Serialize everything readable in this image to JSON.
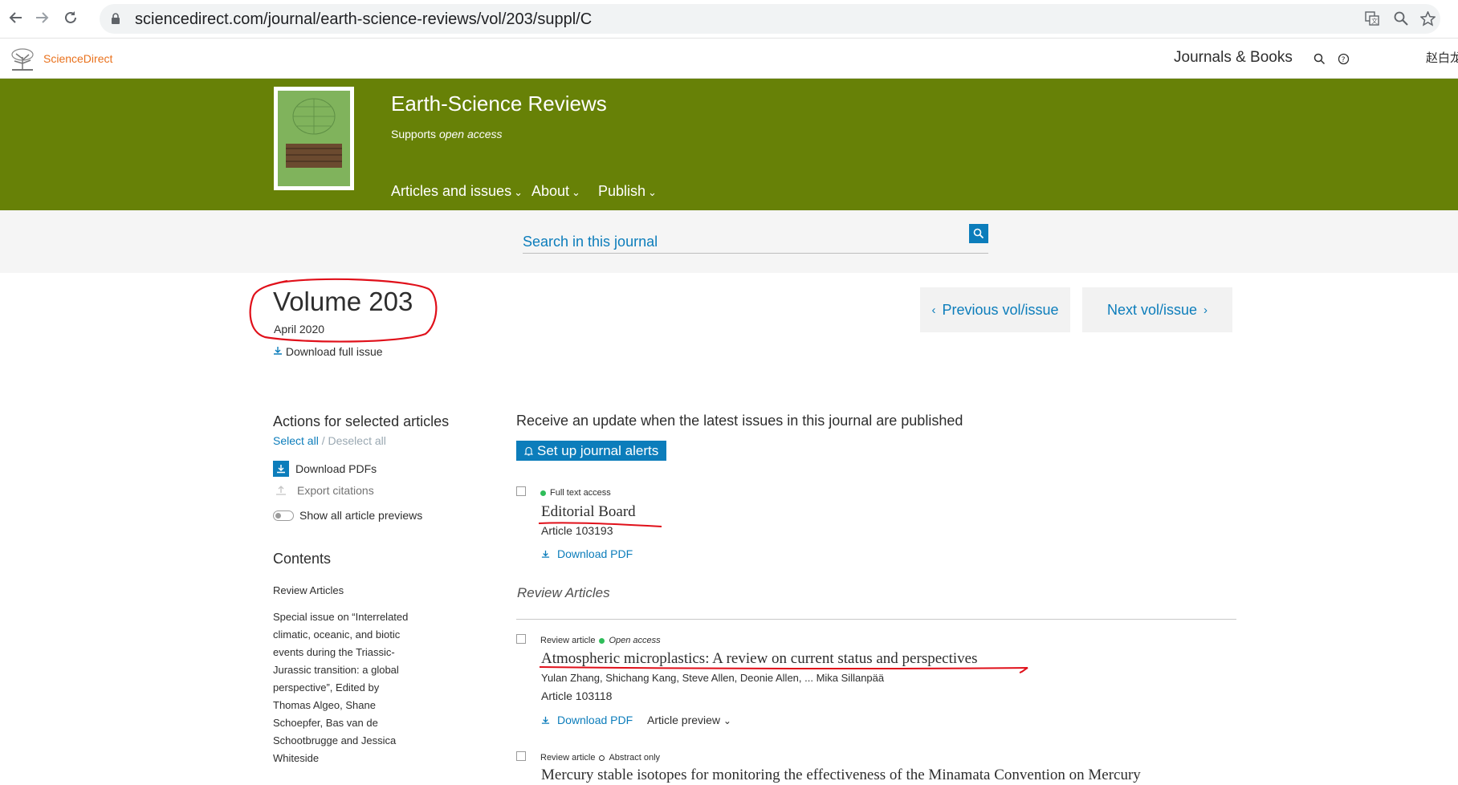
{
  "browser": {
    "url": "sciencedirect.com/journal/earth-science-reviews/vol/203/suppl/C",
    "back_icon": "arrow-left",
    "forward_icon": "arrow-right",
    "reload_icon": "reload",
    "translate_icon": "translate",
    "zoom_icon": "magnifier",
    "bookmark_icon": "star"
  },
  "site_header": {
    "brand": "ScienceDirect",
    "journals_books": "Journals & Books",
    "user": "赵白龙"
  },
  "journal": {
    "title": "Earth-Science Reviews",
    "supports": "Supports",
    "open_access": "open access",
    "nav": [
      "Articles and issues",
      "About",
      "Publish"
    ]
  },
  "search": {
    "placeholder": "Search in this journal"
  },
  "volume": {
    "title": "Volume 203",
    "date": "April 2020",
    "download_full": "Download full issue",
    "prev": "Previous vol/issue",
    "next": "Next vol/issue"
  },
  "sidebar": {
    "actions_title": "Actions for selected articles",
    "select_all": "Select all",
    "separator": "/",
    "deselect_all": "Deselect all",
    "download_pdfs": "Download PDFs",
    "export_citations": "Export citations",
    "show_previews": "Show all article previews",
    "contents_title": "Contents",
    "contents_review": "Review Articles",
    "contents_special": "Special issue on “Interrelated climatic, oceanic, and biotic events during the Triassic-Jurassic transition: a global perspective”, Edited by Thomas Algeo, Shane Schoepfer, Bas van de Schootbrugge and Jessica Whiteside"
  },
  "main": {
    "alert_text": "Receive an update when the latest issues in this journal are published",
    "alert_button": "Set up journal alerts",
    "review_heading": "Review Articles",
    "articles": [
      {
        "access": "Full text access",
        "title": "Editorial Board",
        "number": "Article 103193",
        "download": "Download PDF"
      },
      {
        "type": "Review article",
        "access": "Open access",
        "title": "Atmospheric microplastics: A review on current status and perspectives",
        "authors": "Yulan Zhang, Shichang Kang, Steve Allen, Deonie Allen, ... Mika Sillanpää",
        "number": "Article 103118",
        "download": "Download PDF",
        "preview": "Article preview"
      },
      {
        "type": "Review article",
        "access": "Abstract only",
        "title": "Mercury stable isotopes for monitoring the effectiveness of the Minamata Convention on Mercury"
      }
    ]
  },
  "colors": {
    "banner": "#678107",
    "link": "#0c7dbb",
    "brand": "#e9711c",
    "annotation": "#e0101a",
    "access_dot": "#2ebd59"
  }
}
